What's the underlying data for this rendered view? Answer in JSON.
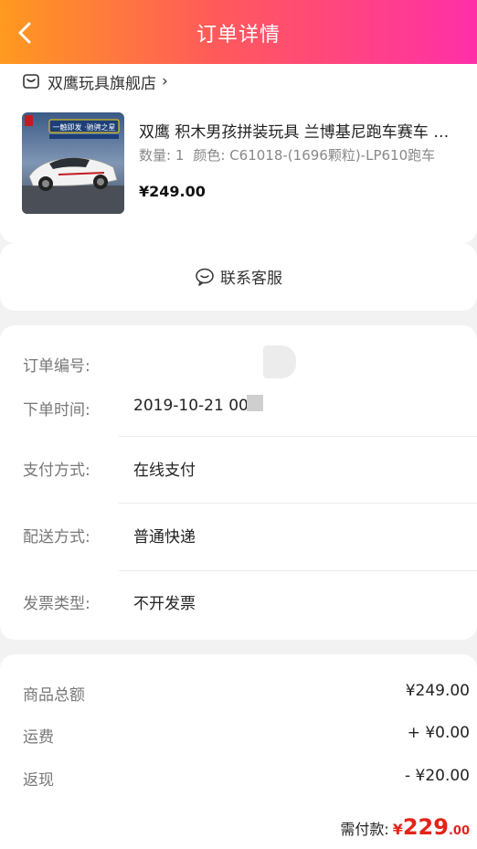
{
  "header": {
    "title": "订单详情"
  },
  "store": {
    "name": "双鹰玩具旗舰店",
    "chevron": "›"
  },
  "product": {
    "title": "双鹰 积木男孩拼装玩具 兰博基尼跑车赛车 …",
    "quantity": "数量: 1",
    "spec": "颜色: C61018-(1696颗粒)-LP610跑车",
    "price": "¥249.00",
    "image_banner": "一触即发 ·驰骋之星"
  },
  "contact": {
    "label": "联系客服"
  },
  "order_info": {
    "order_no_label": "订单编号:",
    "order_time_label": "下单时间:",
    "order_time_value": "2019-10-21 00",
    "payment_label": "支付方式:",
    "payment_value": "在线支付",
    "delivery_label": "配送方式:",
    "delivery_value": "普通快递",
    "invoice_label": "发票类型:",
    "invoice_value": "不开发票"
  },
  "totals": {
    "goods_label": "商品总额",
    "goods_value": "¥249.00",
    "shipping_label": "运费",
    "shipping_value": "+ ¥0.00",
    "cashback_label": "返现",
    "cashback_value": "- ¥20.00",
    "pay_label": "需付款:",
    "pay_currency": "¥",
    "pay_int": "229",
    "pay_dec": ".00"
  },
  "colors": {
    "accent_red": "#e4231a",
    "header_start": "#ff9a1f",
    "header_end": "#ff2fa8"
  },
  "icons": {
    "back": "chevron-left-icon",
    "store": "store-icon",
    "contact": "chat-icon"
  }
}
